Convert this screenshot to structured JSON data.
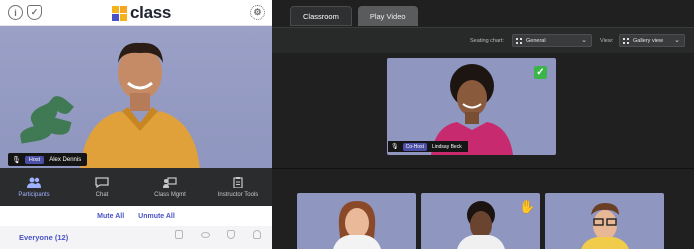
{
  "app": {
    "logo_text": "class"
  },
  "left": {
    "self_video": {
      "name": "Alex Dennis",
      "role": "Host"
    },
    "toolbar": [
      {
        "label": "Participants",
        "icon": "participants-icon",
        "active": true
      },
      {
        "label": "Chat",
        "icon": "chat-icon",
        "active": false
      },
      {
        "label": "Class Mgmt",
        "icon": "class-mgmt-icon",
        "active": false
      },
      {
        "label": "Instructor Tools",
        "icon": "clipboard-icon",
        "active": false
      }
    ],
    "mute_all": "Mute All",
    "unmute_all": "Unmute All",
    "everyone": "Everyone (12)"
  },
  "right": {
    "tabs": [
      {
        "label": "Classroom",
        "active": true
      },
      {
        "label": "Play Video",
        "active": false
      }
    ],
    "seating_label": "Seating chart:",
    "seating_value": "General",
    "view_label": "View:",
    "view_value": "Gallery view",
    "stage": {
      "name": "Lindsay Beck",
      "role": "Co-Host",
      "checkmark": "✓"
    },
    "students": [
      {
        "hand_raised": false
      },
      {
        "hand_raised": true
      },
      {
        "hand_raised": false
      }
    ]
  },
  "colors": {
    "accent": "#4a53c4",
    "host_pill": "#4b4fa7",
    "video_bg": "#8f96bf",
    "dark_bg": "#1f201f"
  }
}
